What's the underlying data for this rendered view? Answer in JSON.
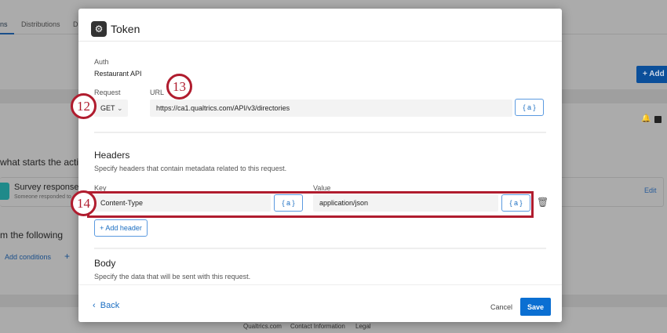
{
  "background": {
    "tabs": [
      "ns",
      "Distributions",
      "D"
    ],
    "add_button": "Add",
    "trigger_heading": "what starts the actio",
    "trigger_title": "Survey response",
    "trigger_subtitle": "Someone responded to",
    "edit_link": "Edit",
    "conditions_heading": "m the following",
    "add_conditions": "Add conditions",
    "footer_links": [
      "Qualtrics.com",
      "Contact Information",
      "Legal"
    ]
  },
  "modal": {
    "title": "Token",
    "auth_label": "Auth",
    "auth_value": "Restaurant API",
    "request_label": "Request",
    "request_method": "GET",
    "url_label": "URL",
    "url_value": "https://ca1.qualtrics.com/API/v3/directories",
    "piped_text": "{ a }",
    "headers_title": "Headers",
    "headers_desc": "Specify headers that contain metadata related to this request.",
    "key_label": "Key",
    "value_label": "Value",
    "header_key": "Content-Type",
    "header_value": "application/json",
    "add_header": "+ Add header",
    "body_title": "Body",
    "body_desc": "Specify the data that will be sent with this request.",
    "back": "Back",
    "cancel": "Cancel",
    "save": "Save"
  },
  "annotations": [
    "12",
    "13",
    "14"
  ]
}
